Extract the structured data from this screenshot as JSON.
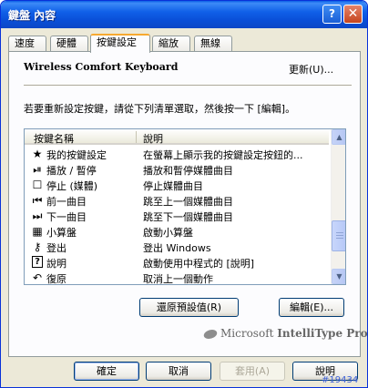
{
  "window": {
    "title": "鍵盤 內容",
    "help_glyph": "?",
    "close_glyph": "✕"
  },
  "tabs": [
    {
      "label": "速度"
    },
    {
      "label": "硬體"
    },
    {
      "label": "按鍵設定",
      "active": true
    },
    {
      "label": "縮放"
    },
    {
      "label": "無線"
    }
  ],
  "panel": {
    "heading": "Wireless Comfort Keyboard",
    "update_link": "更新(U)...",
    "instruction": "若要重新設定按鍵，請從下列清單選取，然後按一下 [編輯]。"
  },
  "list": {
    "columns": [
      "按鍵名稱",
      "說明"
    ],
    "rows": [
      {
        "icon": "star-icon",
        "glyph": "★",
        "name": "我的按鍵設定",
        "desc": "在螢幕上顯示我的按鍵設定按鈕的..."
      },
      {
        "icon": "play-pause-icon",
        "glyph": "⏯",
        "name": "播放 / 暫停",
        "desc": "播放和暫停媒體曲目"
      },
      {
        "icon": "stop-icon",
        "glyph": "☐",
        "name": "停止 (媒體)",
        "desc": "停止媒體曲目"
      },
      {
        "icon": "previous-track-icon",
        "glyph": "⏮",
        "name": "前一曲目",
        "desc": "跳至上一個媒體曲目"
      },
      {
        "icon": "next-track-icon",
        "glyph": "⏭",
        "name": "下一曲目",
        "desc": "跳至下一個媒體曲目"
      },
      {
        "icon": "calculator-icon",
        "glyph": "▦",
        "name": "小算盤",
        "desc": "啟動小算盤"
      },
      {
        "icon": "key-icon",
        "glyph": "⚷",
        "name": "登出",
        "desc": "登出 Windows"
      },
      {
        "icon": "help-icon",
        "glyph": "?",
        "name": "說明",
        "desc": "啟動使用中程式的 [說明]"
      },
      {
        "icon": "undo-icon",
        "glyph": "↶",
        "name": "復原",
        "desc": "取消上一個動作"
      }
    ]
  },
  "buttons": {
    "restore_defaults": "還原預設值(R)",
    "edit": "編輯(E)...",
    "ok": "確定",
    "cancel": "取消",
    "apply": "套用(A)",
    "help": "說明"
  },
  "brand": {
    "prefix": "Microsoft",
    "bold": "IntelliType Pro"
  },
  "watermark": "#19434"
}
